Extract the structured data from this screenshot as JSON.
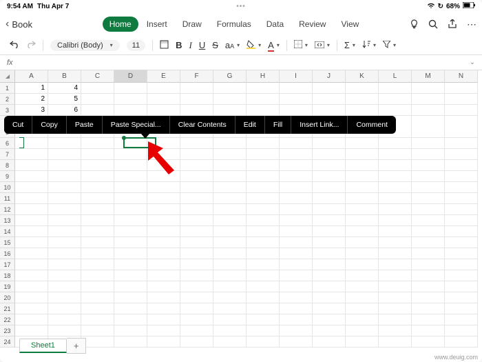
{
  "status": {
    "time": "9:54 AM",
    "date": "Thu Apr 7",
    "battery": "68%",
    "battery_icon": "▮"
  },
  "header": {
    "back_label": "Book",
    "tabs": [
      "Home",
      "Insert",
      "Draw",
      "Formulas",
      "Data",
      "Review",
      "View"
    ],
    "active_tab": 0
  },
  "toolbar": {
    "font_name": "Calibri (Body)",
    "font_size": "11"
  },
  "formula_bar": {
    "fx": "fx"
  },
  "columns": [
    "A",
    "B",
    "C",
    "D",
    "E",
    "F",
    "G",
    "H",
    "I",
    "J",
    "K",
    "L",
    "M",
    "N"
  ],
  "selected_column_index": 3,
  "row_count": 24,
  "cells": {
    "A1": "1",
    "B1": "4",
    "A2": "2",
    "B2": "5",
    "A3": "3",
    "B3": "6"
  },
  "context_menu": [
    "Cut",
    "Copy",
    "Paste",
    "Paste Special...",
    "Clear Contents",
    "Edit",
    "Fill",
    "Insert Link...",
    "Comment"
  ],
  "sheet": {
    "name": "Sheet1",
    "add": "+"
  },
  "watermark": "www.deuig.com",
  "chart_data": {
    "type": "table",
    "columns": [
      "A",
      "B"
    ],
    "rows": [
      [
        1,
        4
      ],
      [
        2,
        5
      ],
      [
        3,
        6
      ]
    ]
  }
}
